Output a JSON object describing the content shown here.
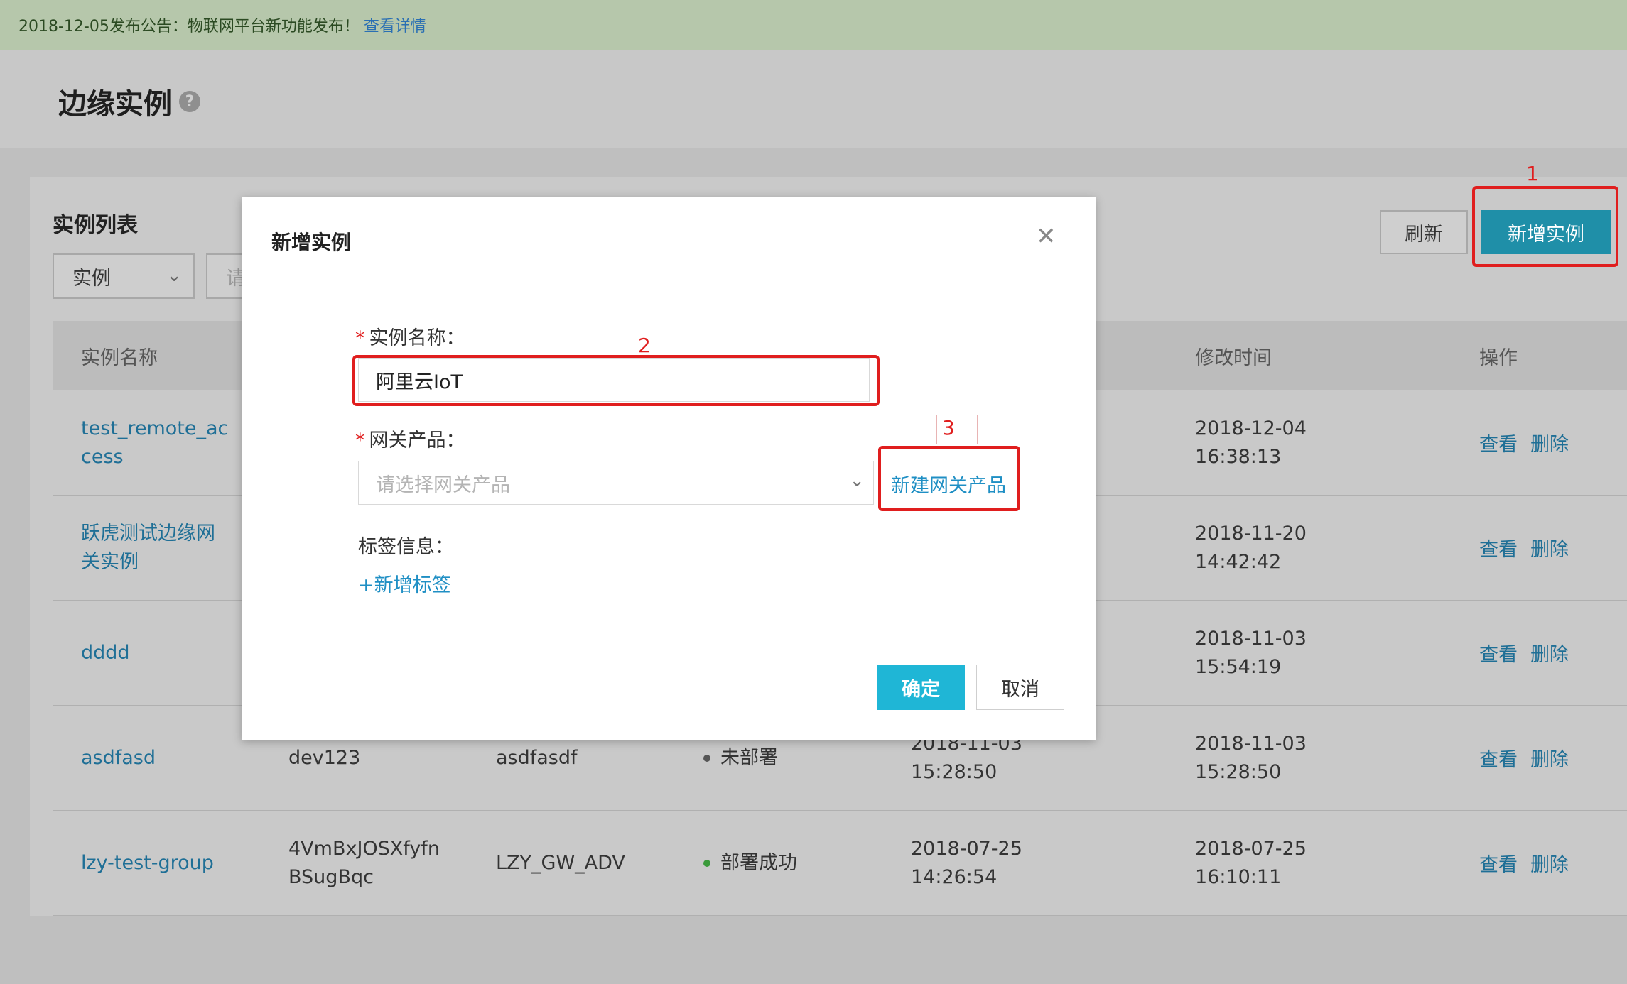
{
  "notice": {
    "text": "2018-12-05发布公告：物联网平台新功能发布！",
    "link": "查看详情"
  },
  "page": {
    "title": "边缘实例",
    "help": "?"
  },
  "list": {
    "title": "实例列表",
    "filter_select": "实例",
    "filter_placeholder": "请",
    "refresh_label": "刷新",
    "new_label": "新增实例"
  },
  "table": {
    "headers": {
      "name": "实例名称",
      "modified": "修改时间",
      "ops": "操作"
    },
    "rows": [
      {
        "name": "test_remote_ac cess",
        "col2": "",
        "col3": "",
        "status": "",
        "created": "",
        "modified": "2018-12-04 16:38:13",
        "view": "查看",
        "delete": "删除"
      },
      {
        "name": "跃虎测试边缘网关实例",
        "col2": "",
        "col3": "",
        "status": "",
        "created": "",
        "modified": "2018-11-20 14:42:42",
        "view": "查看",
        "delete": "删除"
      },
      {
        "name": "dddd",
        "col2": "",
        "col3": "",
        "status": "",
        "created": "",
        "modified": "2018-11-03 15:54:19",
        "view": "查看",
        "delete": "删除"
      },
      {
        "name": "asdfasd",
        "col2": "dev123",
        "col3": "asdfasdf",
        "status": "未部署",
        "created": "2018-11-03 15:28:50",
        "modified": "2018-11-03 15:28:50",
        "view": "查看",
        "delete": "删除"
      },
      {
        "name": "lzy-test-group",
        "col2": "4VmBxJOSXfyfn BSugBqc",
        "col3": "LZY_GW_ADV",
        "status": "部署成功",
        "created": "2018-07-25 14:26:54",
        "modified": "2018-07-25 16:10:11",
        "view": "查看",
        "delete": "删除"
      }
    ]
  },
  "modal": {
    "title": "新增实例",
    "close_icon": "close-icon",
    "required_mark": "*",
    "name_label": "实例名称：",
    "name_value": "阿里云IoT",
    "gateway_label": "网关产品：",
    "gateway_placeholder": "请选择网关产品",
    "new_gateway_link": "新建网关产品",
    "tag_label": "标签信息：",
    "add_tag_link": "+新增标签",
    "ok_label": "确定",
    "cancel_label": "取消"
  },
  "annotations": {
    "step1": "1",
    "step2": "2",
    "step3": "3"
  },
  "colors": {
    "accent": "#1fb6d6",
    "link": "#1f8fc4",
    "annotation": "#e01e1e"
  }
}
